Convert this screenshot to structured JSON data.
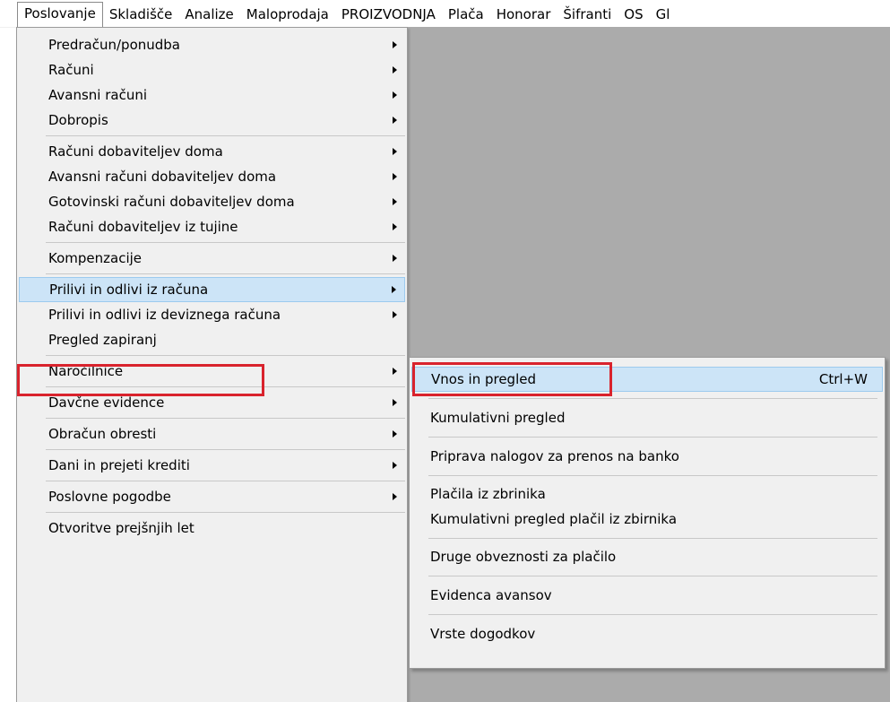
{
  "menubar": {
    "items": [
      {
        "label": "Poslovanje"
      },
      {
        "label": "Skladišče"
      },
      {
        "label": "Analize"
      },
      {
        "label": "Maloprodaja"
      },
      {
        "label": "PROIZVODNJA"
      },
      {
        "label": "Plača"
      },
      {
        "label": "Honorar"
      },
      {
        "label": "Šifranti"
      },
      {
        "label": "OS"
      },
      {
        "label": "Gl"
      }
    ]
  },
  "main_menu": {
    "items": [
      {
        "label": "Predračun/ponudba"
      },
      {
        "label": "Računi"
      },
      {
        "label": "Avansni računi"
      },
      {
        "label": "Dobropis"
      },
      {
        "label": "Računi dobaviteljev doma"
      },
      {
        "label": "Avansni računi dobaviteljev doma"
      },
      {
        "label": "Gotovinski računi dobaviteljev doma"
      },
      {
        "label": "Računi dobaviteljev iz tujine"
      },
      {
        "label": "Kompenzacije"
      },
      {
        "label": "Prilivi in odlivi iz računa"
      },
      {
        "label": "Prilivi in odlivi iz deviznega računa"
      },
      {
        "label": "Pregled zapiranj"
      },
      {
        "label": "Naročilnice"
      },
      {
        "label": "Davčne evidence"
      },
      {
        "label": "Obračun obresti"
      },
      {
        "label": "Dani in prejeti krediti"
      },
      {
        "label": "Poslovne pogodbe"
      },
      {
        "label": "Otvoritve prejšnjih let"
      }
    ]
  },
  "submenu": {
    "items": [
      {
        "label": "Vnos in pregled",
        "shortcut": "Ctrl+W"
      },
      {
        "label": "Kumulativni pregled"
      },
      {
        "label": "Priprava nalogov za prenos na banko"
      },
      {
        "label": "Plačila iz zbrinika"
      },
      {
        "label": "Kumulativni pregled plačil iz zbirnika"
      },
      {
        "label": "Druge obveznosti za plačilo"
      },
      {
        "label": "Evidenca avansov"
      },
      {
        "label": "Vrste dogodkov"
      }
    ]
  },
  "colors": {
    "highlight": "#cce4f7",
    "annotation_red": "#d9232d",
    "workspace_gray": "#ababab"
  }
}
